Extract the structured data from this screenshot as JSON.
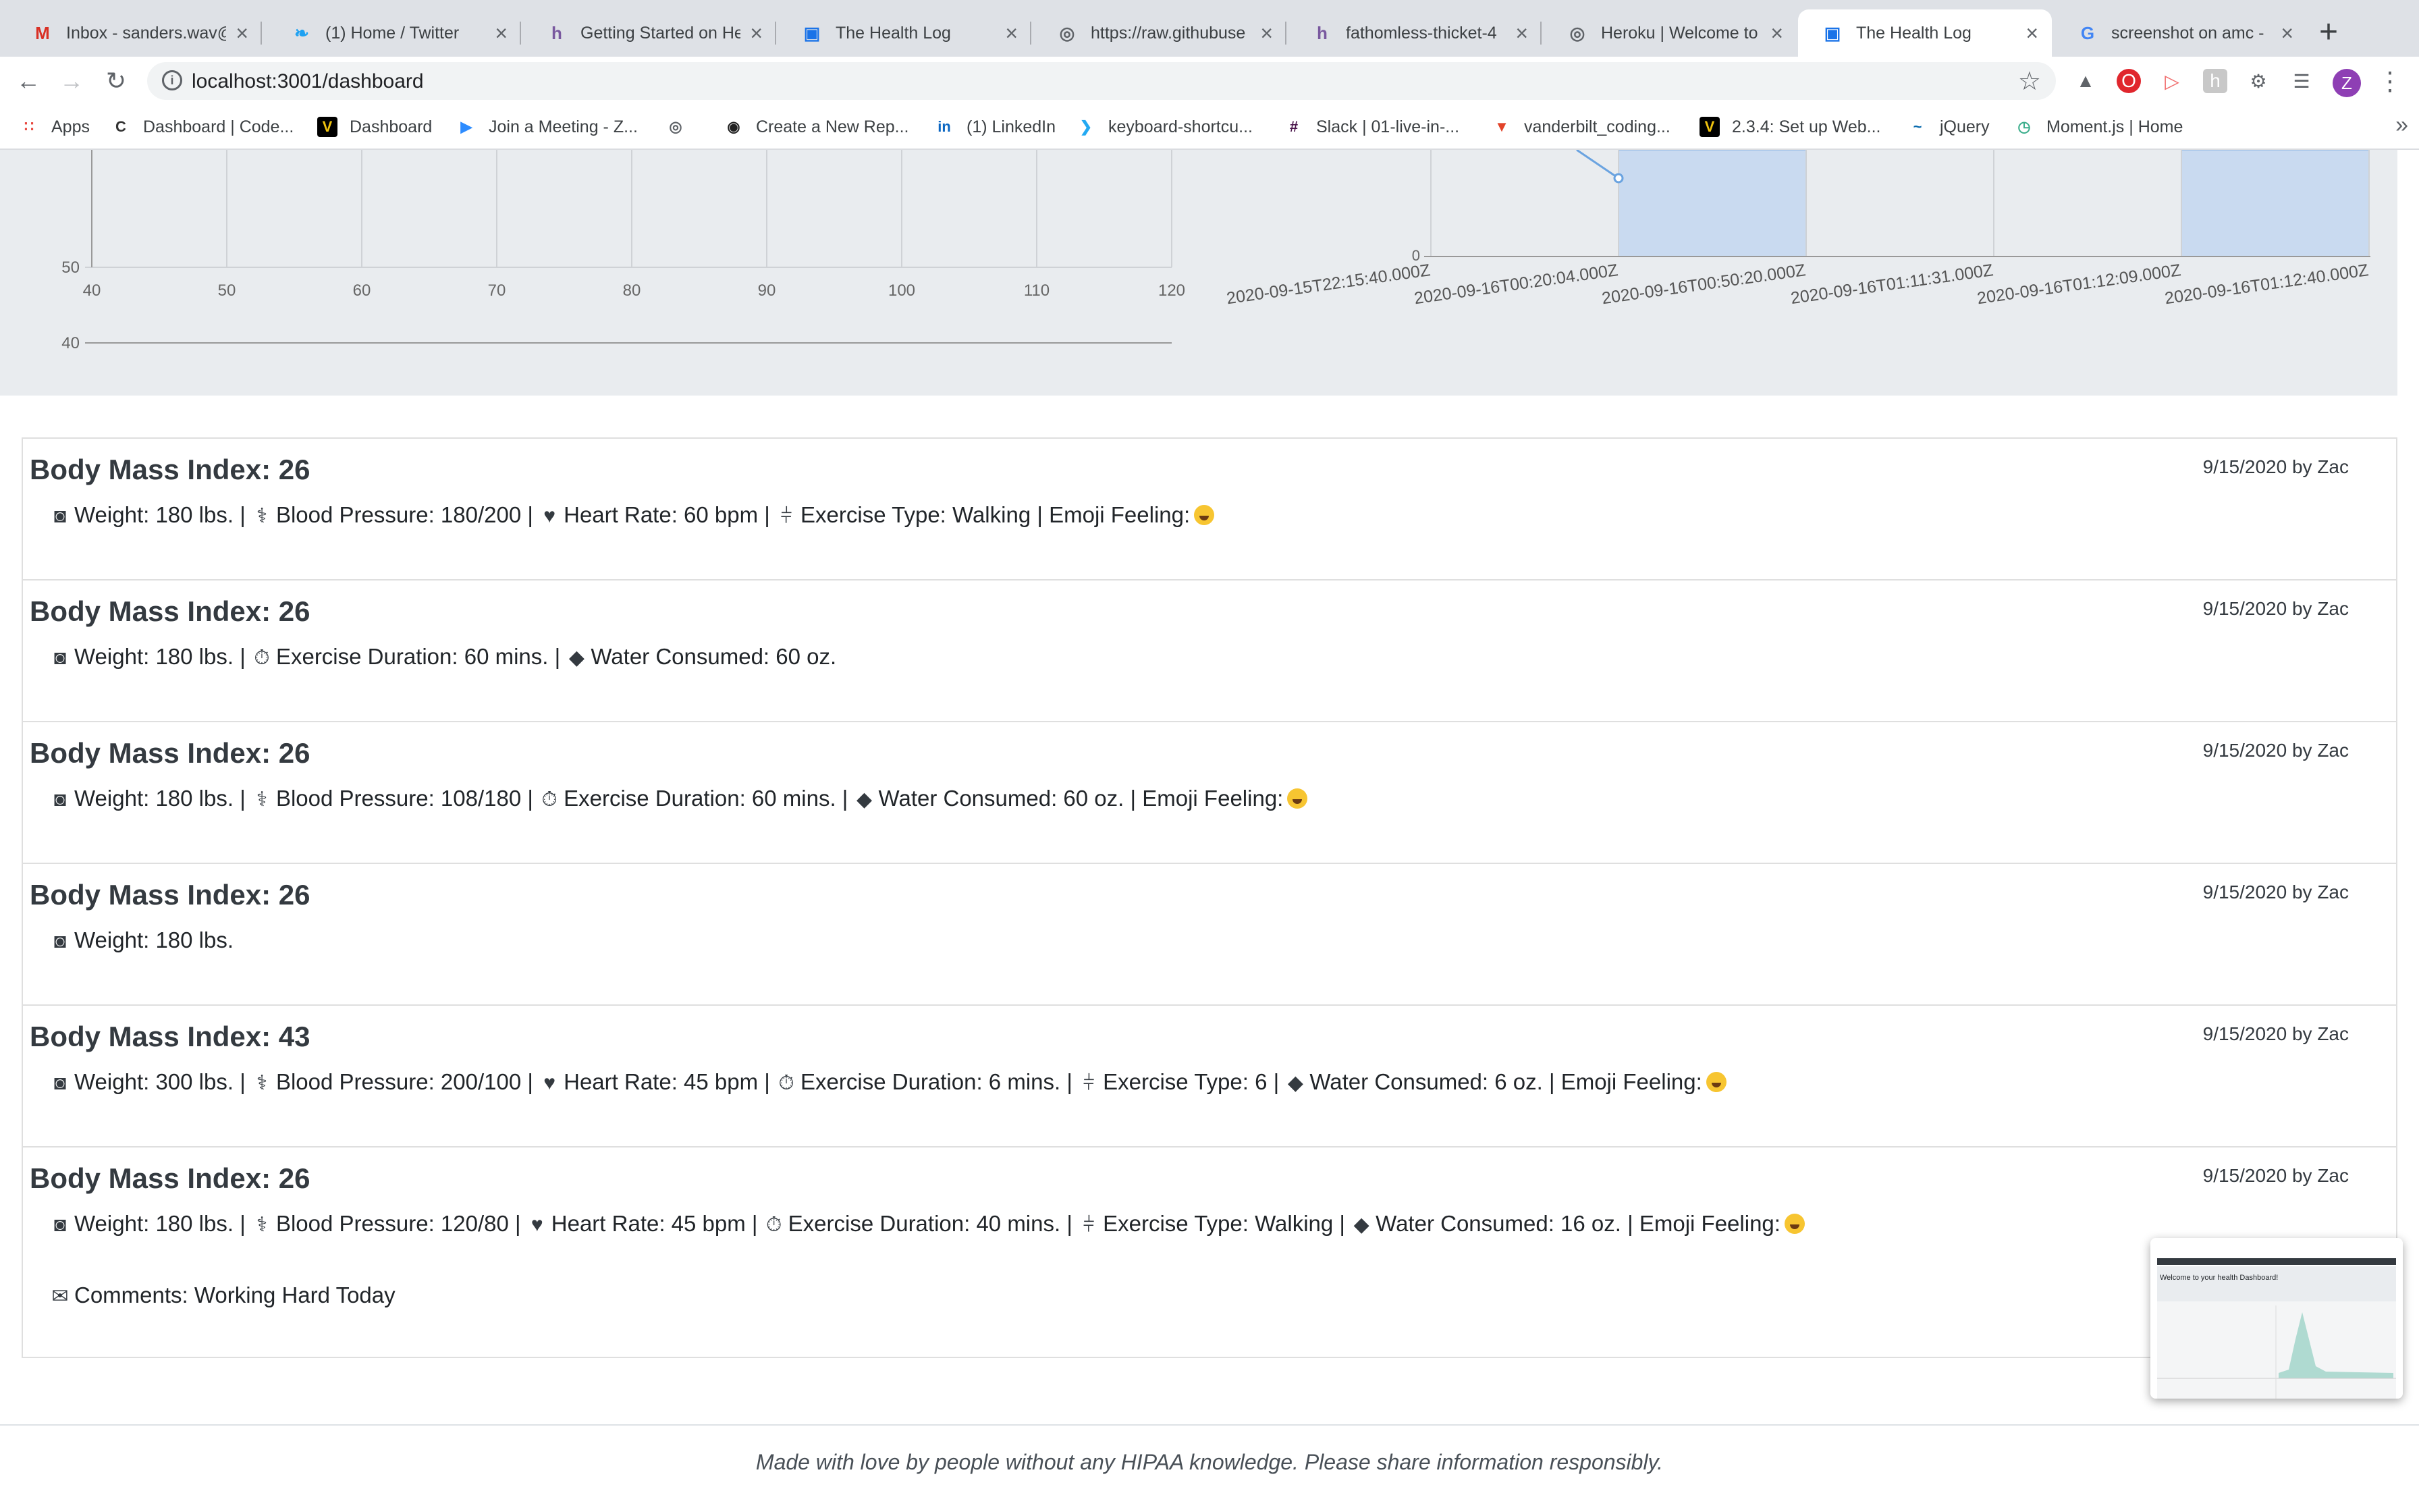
{
  "browser": {
    "tabs": [
      {
        "title": "Inbox - sanders.wav@",
        "icon": "gmail-icon",
        "color": "#d93025"
      },
      {
        "title": "(1) Home / Twitter",
        "icon": "twitter-icon",
        "color": "#1da1f2"
      },
      {
        "title": "Getting Started on He",
        "icon": "heroku-icon",
        "color": "#79589f"
      },
      {
        "title": "The Health Log",
        "icon": "page-icon",
        "color": "#1a73e8"
      },
      {
        "title": "https://raw.githubuse",
        "icon": "globe-icon",
        "color": "#5f6368"
      },
      {
        "title": "fathomless-thicket-4",
        "icon": "heroku-icon",
        "color": "#79589f"
      },
      {
        "title": "Heroku | Welcome to",
        "icon": "globe-icon",
        "color": "#5f6368"
      },
      {
        "title": "The Health Log",
        "icon": "page-icon",
        "color": "#1a73e8",
        "active": true
      },
      {
        "title": "screenshot on amc - ",
        "icon": "google-icon",
        "color": "#4285f4"
      }
    ],
    "url": "localhost:3001/dashboard",
    "bookmarks": [
      {
        "label": "Apps",
        "icon": "apps-grid-icon"
      },
      {
        "label": "Dashboard | Code...",
        "icon": "codecademy-icon"
      },
      {
        "label": "Dashboard",
        "icon": "vanderbilt-icon"
      },
      {
        "label": "Join a Meeting - Z...",
        "icon": "zoom-icon"
      },
      {
        "label": "",
        "icon": "globe-icon"
      },
      {
        "label": "Create a New Rep...",
        "icon": "github-icon"
      },
      {
        "label": "(1) LinkedIn",
        "icon": "linkedin-icon"
      },
      {
        "label": "keyboard-shortcu...",
        "icon": "vscode-icon"
      },
      {
        "label": "Slack | 01-live-in-...",
        "icon": "slack-icon"
      },
      {
        "label": "vanderbilt_coding...",
        "icon": "gitlab-icon"
      },
      {
        "label": "2.3.4: Set up Web...",
        "icon": "vanderbilt-icon"
      },
      {
        "label": "jQuery",
        "icon": "jquery-icon"
      },
      {
        "label": "Moment.js | Home",
        "icon": "moment-icon"
      }
    ]
  },
  "chart_data": [
    {
      "type": "line",
      "x_ticks": [
        "40",
        "50",
        "60",
        "70",
        "80",
        "90",
        "100",
        "110",
        "120"
      ],
      "y_ticks_visible": [
        "50",
        "40"
      ],
      "xlim": [
        40,
        120
      ],
      "ylim_visible": [
        40,
        50
      ],
      "grid": true,
      "series": []
    },
    {
      "type": "area",
      "categories": [
        "2020-09-15T22:15:40.000Z",
        "2020-09-16T00:20:04.000Z",
        "2020-09-16T00:50:20.000Z",
        "2020-09-16T01:11:31.000Z",
        "2020-09-16T01:12:09.000Z",
        "2020-09-16T01:12:40.000Z"
      ],
      "y_ticks_visible": [
        "0"
      ],
      "shaded_bands": [
        [
          1,
          2
        ],
        [
          4,
          5
        ]
      ],
      "grid": true
    }
  ],
  "entries": [
    {
      "bmi": "Body Mass Index: 26",
      "meta": "9/15/2020 by Zac",
      "fields": [
        {
          "icon": "scale-icon",
          "text": "Weight: 180 lbs."
        },
        {
          "icon": "stethoscope-icon",
          "text": "Blood Pressure: 180/200"
        },
        {
          "icon": "heartbeat-icon",
          "text": "Heart Rate: 60 bpm"
        },
        {
          "icon": "dumbbell-icon",
          "text": "Exercise Type: Walking"
        },
        {
          "icon": "",
          "text": "Emoji Feeling:",
          "emoji": true
        }
      ]
    },
    {
      "bmi": "Body Mass Index: 26",
      "meta": "9/15/2020 by Zac",
      "fields": [
        {
          "icon": "scale-icon",
          "text": "Weight: 180 lbs."
        },
        {
          "icon": "stopwatch-icon",
          "text": "Exercise Duration: 60 mins."
        },
        {
          "icon": "water-drop-icon",
          "text": "Water Consumed: 60 oz."
        }
      ]
    },
    {
      "bmi": "Body Mass Index: 26",
      "meta": "9/15/2020 by Zac",
      "fields": [
        {
          "icon": "scale-icon",
          "text": "Weight: 180 lbs."
        },
        {
          "icon": "stethoscope-icon",
          "text": "Blood Pressure: 108/180"
        },
        {
          "icon": "stopwatch-icon",
          "text": "Exercise Duration: 60 mins."
        },
        {
          "icon": "water-drop-icon",
          "text": "Water Consumed: 60 oz."
        },
        {
          "icon": "",
          "text": "Emoji Feeling:",
          "emoji": true
        }
      ]
    },
    {
      "bmi": "Body Mass Index: 26",
      "meta": "9/15/2020 by Zac",
      "fields": [
        {
          "icon": "scale-icon",
          "text": "Weight: 180 lbs."
        }
      ]
    },
    {
      "bmi": "Body Mass Index: 43",
      "meta": "9/15/2020 by Zac",
      "fields": [
        {
          "icon": "scale-icon",
          "text": "Weight: 300 lbs."
        },
        {
          "icon": "stethoscope-icon",
          "text": "Blood Pressure: 200/100"
        },
        {
          "icon": "heartbeat-icon",
          "text": "Heart Rate: 45 bpm"
        },
        {
          "icon": "stopwatch-icon",
          "text": "Exercise Duration: 6 mins."
        },
        {
          "icon": "dumbbell-icon",
          "text": "Exercise Type: 6"
        },
        {
          "icon": "water-drop-icon",
          "text": "Water Consumed: 6 oz."
        },
        {
          "icon": "",
          "text": "Emoji Feeling:",
          "emoji": true
        }
      ]
    },
    {
      "bmi": "Body Mass Index: 26",
      "meta": "9/15/2020 by Zac",
      "fields": [
        {
          "icon": "scale-icon",
          "text": "Weight: 180 lbs."
        },
        {
          "icon": "stethoscope-icon",
          "text": "Blood Pressure: 120/80"
        },
        {
          "icon": "heartbeat-icon",
          "text": "Heart Rate: 45 bpm"
        },
        {
          "icon": "stopwatch-icon",
          "text": "Exercise Duration: 40 mins."
        },
        {
          "icon": "dumbbell-icon",
          "text": "Exercise Type: Walking"
        },
        {
          "icon": "water-drop-icon",
          "text": "Water Consumed: 16 oz."
        },
        {
          "icon": "",
          "text": "Emoji Feeling:",
          "emoji": true
        }
      ],
      "comment": "Comments: Working Hard Today"
    }
  ],
  "footer": "Made with love by people without any HIPAA knowledge. Please share information responsibly.",
  "thumbnail": {
    "heading": "Welcome to your health Dashboard!"
  }
}
